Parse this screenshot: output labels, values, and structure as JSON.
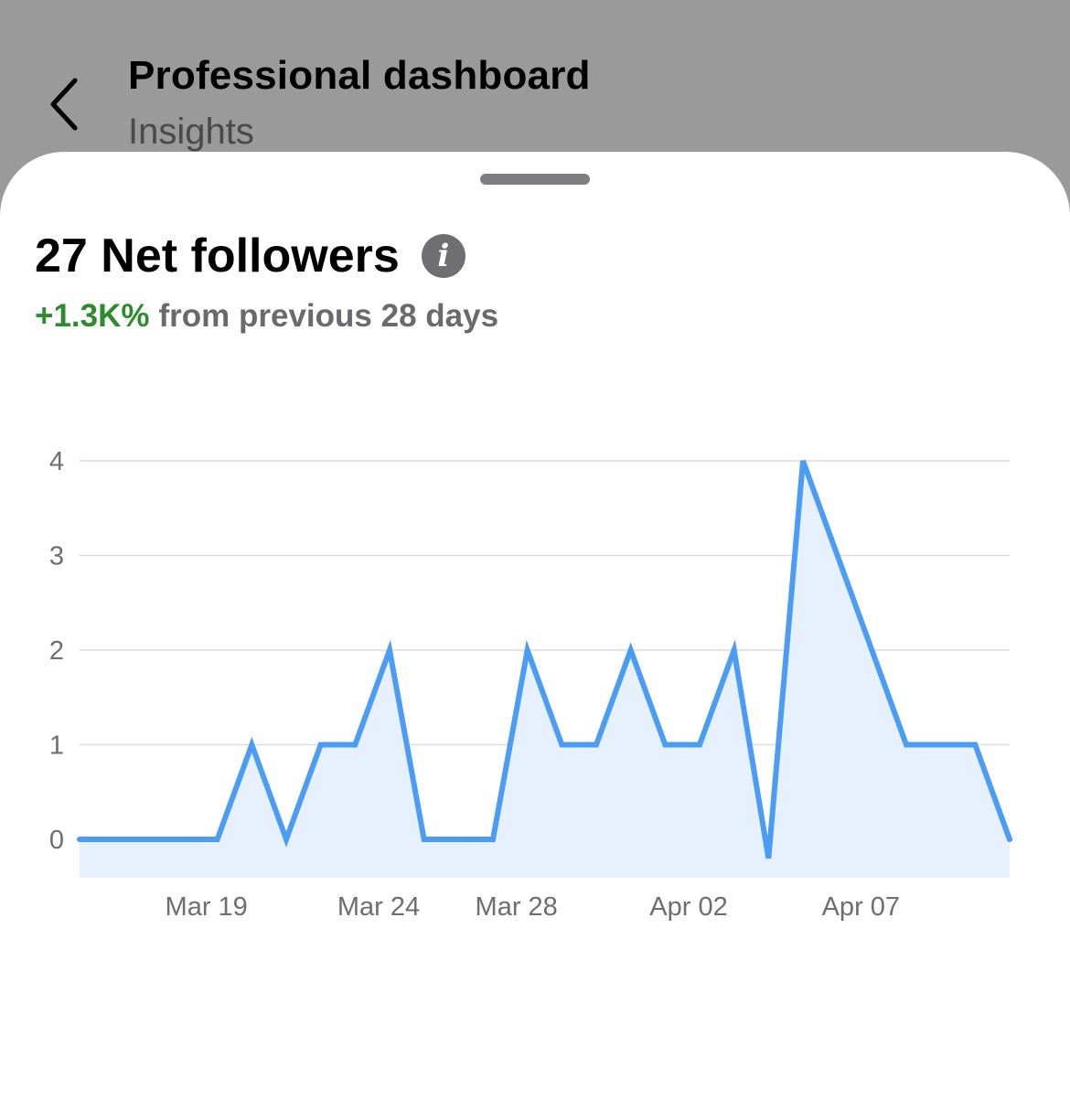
{
  "header": {
    "title": "Professional dashboard",
    "subtitle": "Insights",
    "back_icon": "chevron-left-icon"
  },
  "metric": {
    "value_label": "27 Net followers",
    "change_percent": "+1.3K%",
    "change_text": "from previous 28 days",
    "info_icon": "info-icon"
  },
  "colors": {
    "line": "#4a9cf5",
    "fill": "#e6f1fd",
    "positive": "#2e8b2e",
    "grid": "#dcdcdc"
  },
  "chart_data": {
    "type": "area",
    "x": [
      "Mar 15",
      "Mar 16",
      "Mar 17",
      "Mar 18",
      "Mar 19",
      "Mar 20",
      "Mar 21",
      "Mar 22",
      "Mar 23",
      "Mar 24",
      "Mar 25",
      "Mar 26",
      "Mar 27",
      "Mar 28",
      "Mar 29",
      "Mar 30",
      "Mar 31",
      "Apr 01",
      "Apr 02",
      "Apr 03",
      "Apr 04",
      "Apr 05",
      "Apr 06",
      "Apr 07",
      "Apr 08",
      "Apr 09",
      "Apr 10",
      "Apr 11"
    ],
    "values": [
      0,
      0,
      0,
      0,
      0,
      1,
      0,
      1,
      1,
      2,
      0,
      0,
      0,
      2,
      1,
      1,
      2,
      1,
      1,
      2,
      -0.2,
      4,
      3,
      2,
      1,
      1,
      1,
      0
    ],
    "y_ticks": [
      0,
      1,
      2,
      3,
      4
    ],
    "x_tick_labels": [
      "Mar 19",
      "Mar 24",
      "Mar 28",
      "Apr 02",
      "Apr 07"
    ],
    "ylim": [
      -0.4,
      4.1
    ],
    "grid": true
  }
}
